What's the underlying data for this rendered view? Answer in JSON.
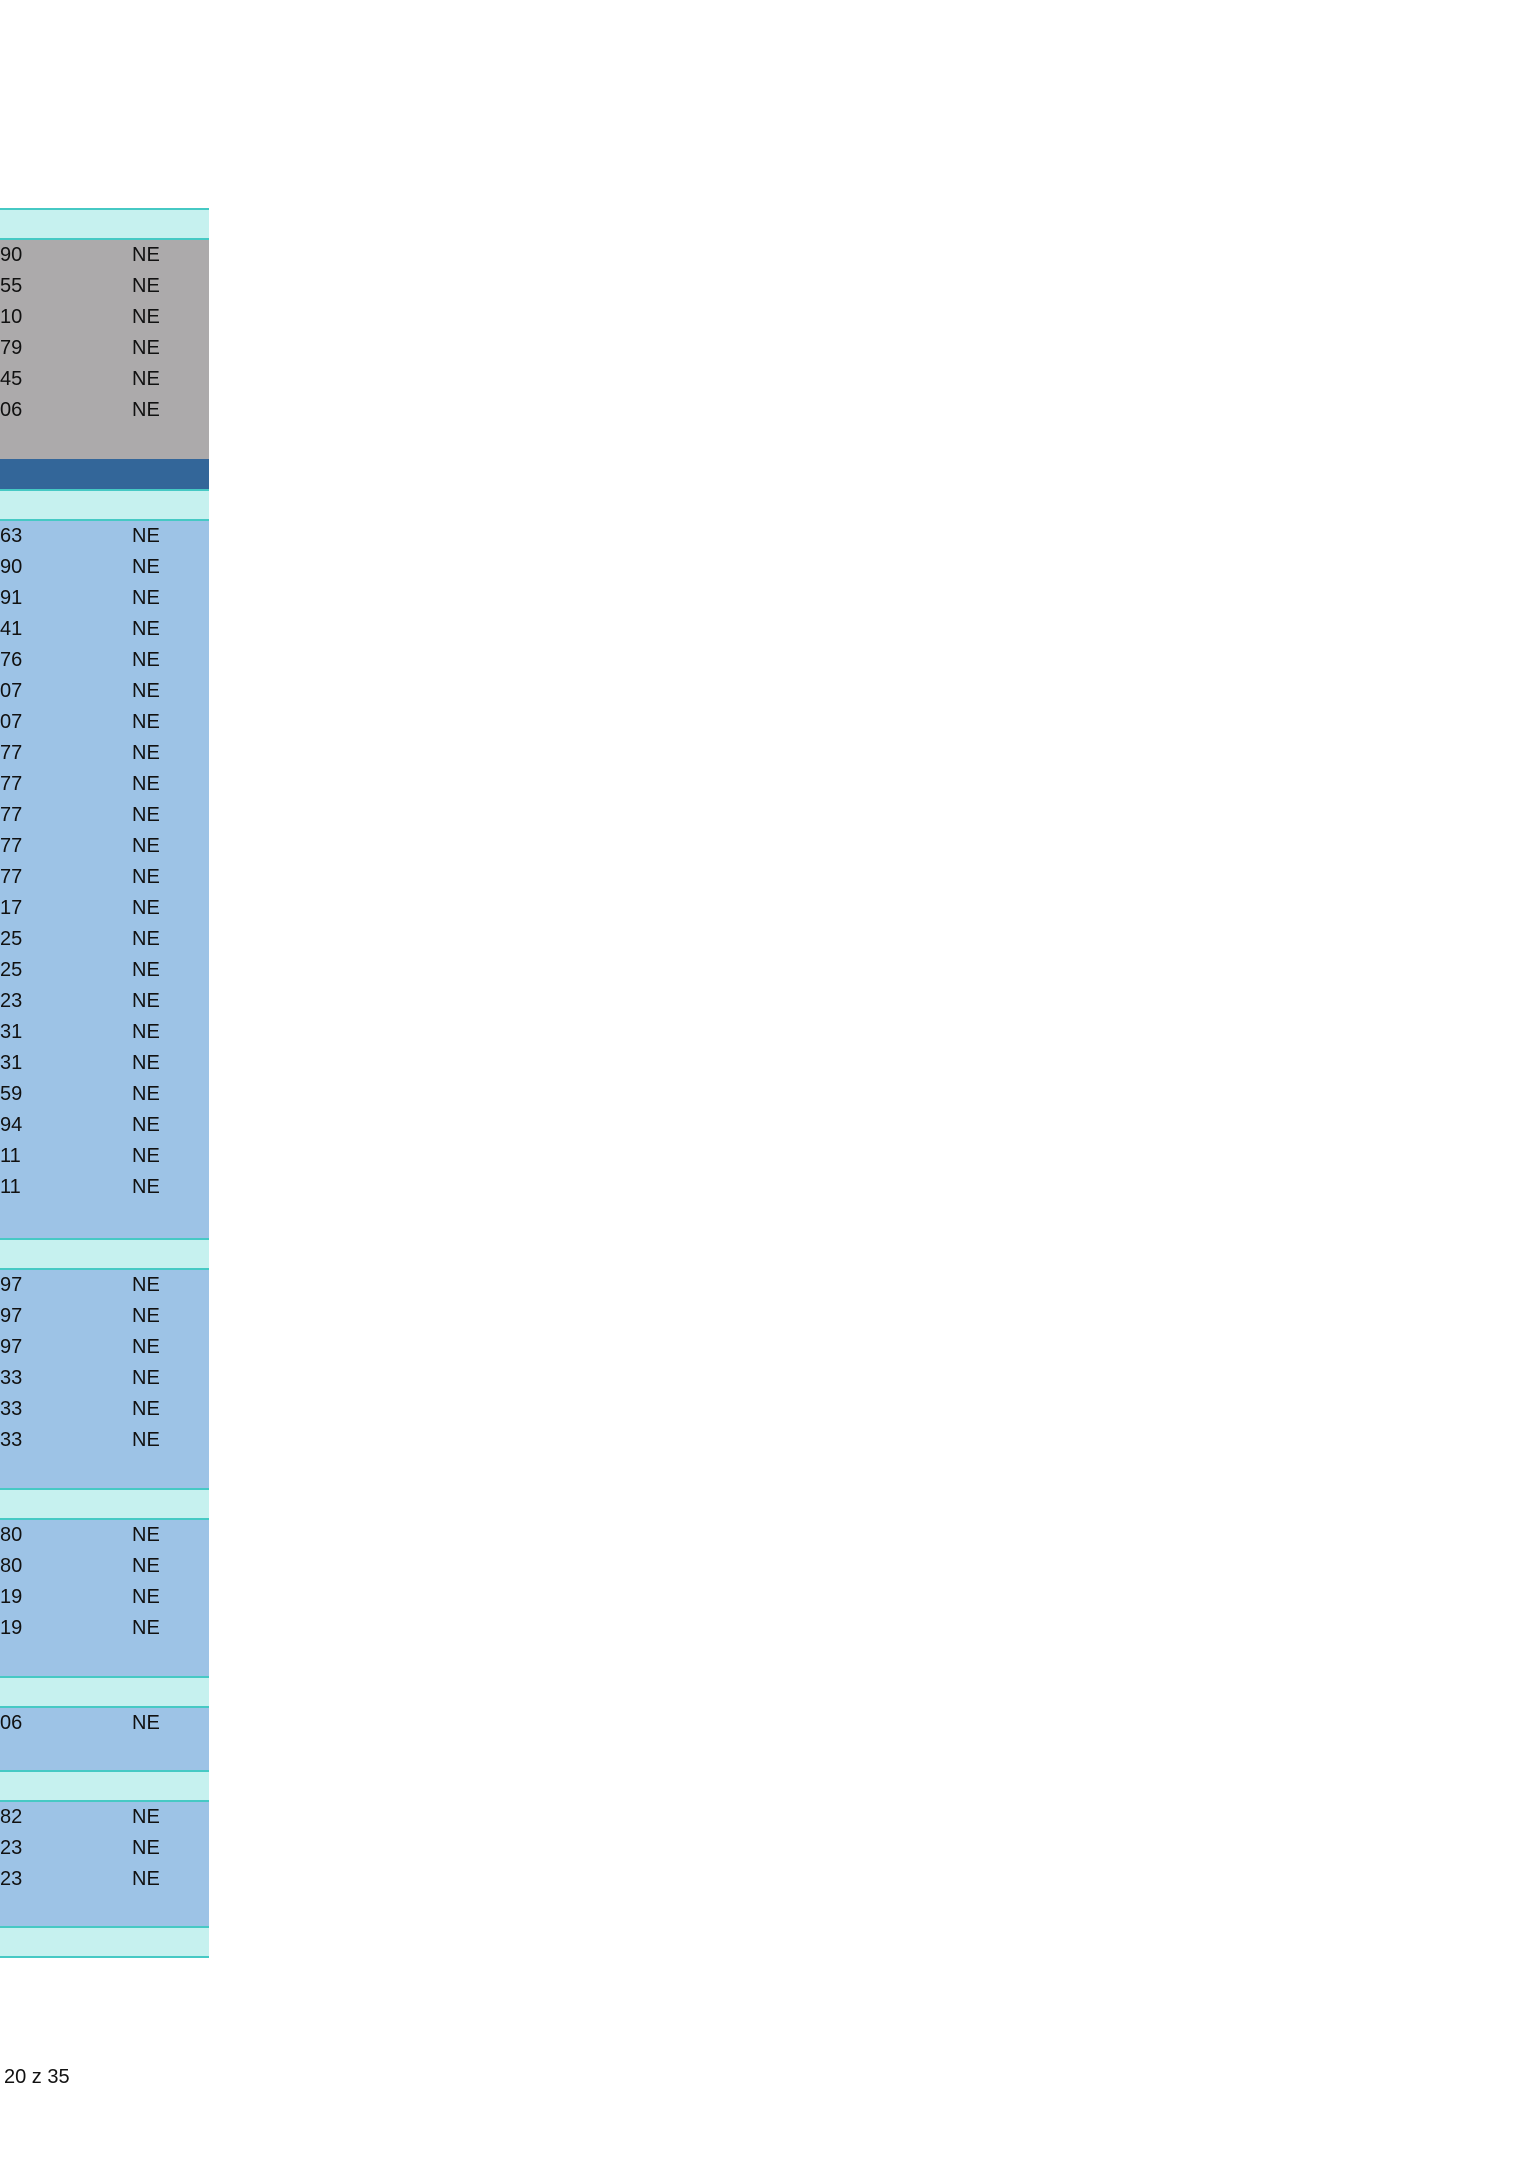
{
  "footer": {
    "page_label": "20 z 35"
  },
  "groups": [
    {
      "rows": [
        {
          "v": "90",
          "f": "NE"
        },
        {
          "v": "55",
          "f": "NE"
        },
        {
          "v": "10",
          "f": "NE"
        },
        {
          "v": "79",
          "f": "NE"
        },
        {
          "v": "45",
          "f": "NE"
        },
        {
          "v": "06",
          "f": "NE"
        }
      ]
    },
    {
      "rows": [
        {
          "v": "63",
          "f": "NE"
        },
        {
          "v": "90",
          "f": "NE"
        },
        {
          "v": "91",
          "f": "NE"
        },
        {
          "v": "41",
          "f": "NE"
        },
        {
          "v": "76",
          "f": "NE"
        },
        {
          "v": "07",
          "f": "NE"
        },
        {
          "v": "07",
          "f": "NE"
        },
        {
          "v": "77",
          "f": "NE"
        },
        {
          "v": "77",
          "f": "NE"
        },
        {
          "v": "77",
          "f": "NE"
        },
        {
          "v": "77",
          "f": "NE"
        },
        {
          "v": "77",
          "f": "NE"
        },
        {
          "v": "17",
          "f": "NE"
        },
        {
          "v": "25",
          "f": "NE"
        },
        {
          "v": "25",
          "f": "NE"
        },
        {
          "v": "23",
          "f": "NE"
        },
        {
          "v": "31",
          "f": "NE"
        },
        {
          "v": "31",
          "f": "NE"
        },
        {
          "v": "59",
          "f": "NE"
        },
        {
          "v": "94",
          "f": "NE"
        },
        {
          "v": "11",
          "f": "NE"
        },
        {
          "v": "11",
          "f": "NE"
        }
      ]
    },
    {
      "rows": [
        {
          "v": "97",
          "f": "NE"
        },
        {
          "v": "97",
          "f": "NE"
        },
        {
          "v": "97",
          "f": "NE"
        },
        {
          "v": "33",
          "f": "NE"
        },
        {
          "v": "33",
          "f": "NE"
        },
        {
          "v": "33",
          "f": "NE"
        }
      ]
    },
    {
      "rows": [
        {
          "v": "80",
          "f": "NE"
        },
        {
          "v": "80",
          "f": "NE"
        },
        {
          "v": "19",
          "f": "NE"
        },
        {
          "v": "19",
          "f": "NE"
        }
      ]
    },
    {
      "rows": [
        {
          "v": "06",
          "f": "NE"
        }
      ]
    },
    {
      "rows": [
        {
          "v": "82",
          "f": "NE"
        },
        {
          "v": "23",
          "f": "NE"
        },
        {
          "v": "23",
          "f": "NE"
        }
      ]
    }
  ]
}
